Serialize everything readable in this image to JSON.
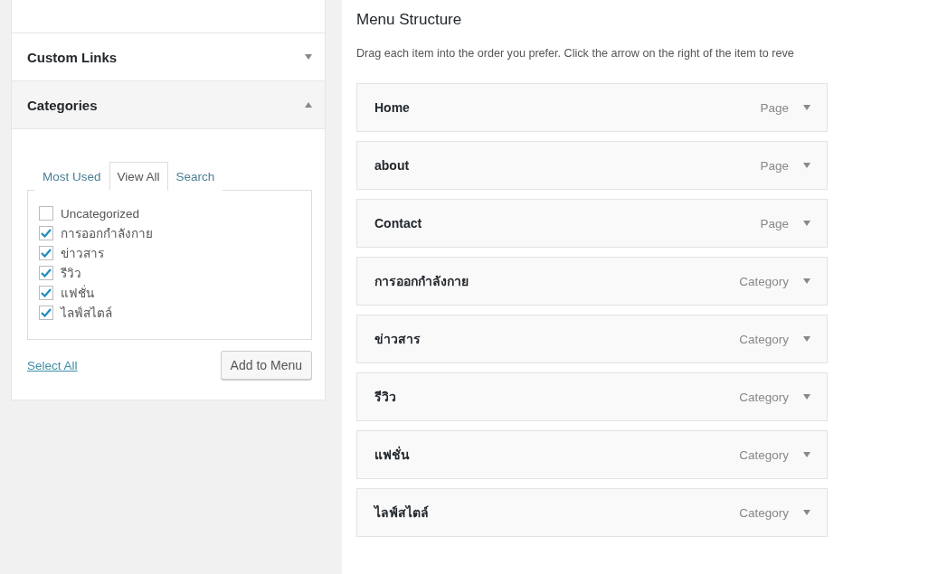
{
  "sidebar": {
    "sections": [
      {
        "title": "Custom Links",
        "expanded": false
      },
      {
        "title": "Categories",
        "expanded": true
      }
    ],
    "tabs": [
      {
        "label": "Most Used",
        "selected": false
      },
      {
        "label": "View All",
        "selected": true
      },
      {
        "label": "Search",
        "selected": false
      }
    ],
    "categories": [
      {
        "label": "Uncategorized",
        "checked": false
      },
      {
        "label": "การออกกำลังกาย",
        "checked": true
      },
      {
        "label": "ข่าวสาร",
        "checked": true
      },
      {
        "label": "รีวิว",
        "checked": true
      },
      {
        "label": "แฟชั่น",
        "checked": true
      },
      {
        "label": "ไลฟ์สไตล์",
        "checked": true
      }
    ],
    "select_all": "Select All",
    "add_button": "Add to Menu"
  },
  "menu_structure": {
    "title": "Menu Structure",
    "description": "Drag each item into the order you prefer. Click the arrow on the right of the item to reve",
    "items": [
      {
        "title": "Home",
        "type": "Page"
      },
      {
        "title": "about",
        "type": "Page"
      },
      {
        "title": "Contact",
        "type": "Page"
      },
      {
        "title": "การออกกำลังกาย",
        "type": "Category"
      },
      {
        "title": "ข่าวสาร",
        "type": "Category"
      },
      {
        "title": "รีวิว",
        "type": "Category"
      },
      {
        "title": "แฟชั่น",
        "type": "Category"
      },
      {
        "title": "ไลฟ์สไตล์",
        "type": "Category"
      }
    ]
  }
}
